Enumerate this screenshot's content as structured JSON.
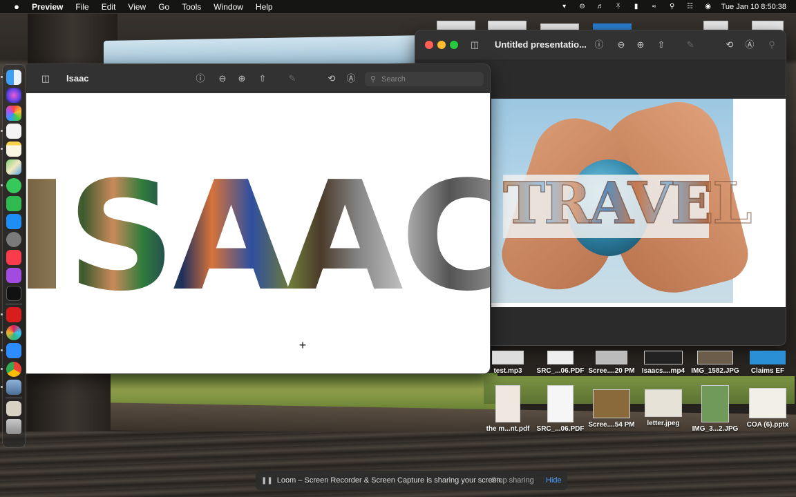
{
  "menubar": {
    "apple": "",
    "items": [
      "Preview",
      "File",
      "Edit",
      "View",
      "Go",
      "Tools",
      "Window",
      "Help"
    ],
    "clock": "Tue Jan 10  8:50:38"
  },
  "isaac_window": {
    "title": "Isaac",
    "search_placeholder": "Search",
    "slide_text": "ISAAC"
  },
  "presentation_window": {
    "title": "Untitled presentatio...",
    "slide_text": "TRAVEL"
  },
  "desktop_files": [
    {
      "name": "test.mp3"
    },
    {
      "name": "SRC_...06.PDF"
    },
    {
      "name": "Scree....20 PM"
    },
    {
      "name": "Isaacs....mp4"
    },
    {
      "name": "IMG_1582.JPG"
    },
    {
      "name": "Claims EF"
    },
    {
      "name": "the m...nt.pdf"
    },
    {
      "name": "SRC_...06.PDF"
    },
    {
      "name": "Scree....54 PM"
    },
    {
      "name": "letter.jpeg"
    },
    {
      "name": "IMG_3...2.JPG"
    },
    {
      "name": "COA (6).pptx"
    }
  ],
  "loom_bar": {
    "message": "Loom – Screen Recorder & Screen Capture is sharing your screen.",
    "stop_label": "Stop sharing",
    "hide_label": "Hide"
  },
  "dock": {
    "apps": [
      "finder-icon",
      "siri-icon",
      "launchpad-icon",
      "reminders-icon",
      "notes-icon",
      "maps-icon",
      "messages-icon",
      "facetime-icon",
      "appstore-icon",
      "settings-icon",
      "news-icon",
      "podcasts-icon",
      "appletv-icon",
      "acrobat-icon",
      "slack-icon",
      "zoom-icon",
      "chrome-icon",
      "preview-icon",
      "archive-icon",
      "trash-icon"
    ]
  },
  "colors": {
    "menubar_bg": "#121212",
    "toolbar_bg": "#323232",
    "link_blue": "#4ea1ff"
  }
}
